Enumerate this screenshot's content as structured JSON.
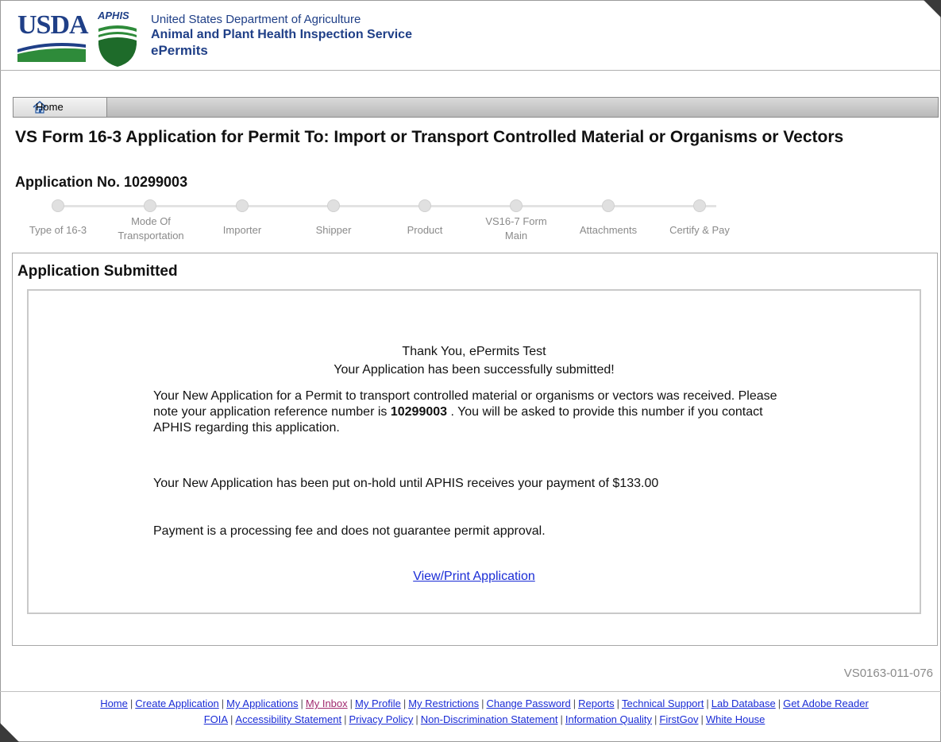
{
  "header": {
    "usda_logo_text": "USDA",
    "aphis_label": "APHIS",
    "line1": "United States Department of Agriculture",
    "line2": "Animal and Plant Health Inspection Service",
    "line3": "ePermits"
  },
  "nav": {
    "home_label": "Home"
  },
  "page": {
    "title": "VS Form 16-3 Application for Permit To: Import or Transport Controlled Material or Organisms or Vectors",
    "application_no": "Application No. 10299003"
  },
  "wizard": {
    "steps": [
      {
        "label": "Type of 16-3"
      },
      {
        "label": "Mode Of Transportation"
      },
      {
        "label": "Importer"
      },
      {
        "label": "Shipper"
      },
      {
        "label": "Product"
      },
      {
        "label": "VS16-7 Form Main"
      },
      {
        "label": "Attachments"
      },
      {
        "label": "Certify & Pay"
      }
    ]
  },
  "panel": {
    "section_title": "Application Submitted",
    "thank_you": "Thank You, ePermits Test",
    "success": "Your Application has been successfully submitted!",
    "para1_before": "Your New Application for a Permit to transport controlled material or organisms or vectors was received. Please note your application reference number is ",
    "para1_ref": "10299003",
    "para1_after": " . You will be asked to provide this number if you contact APHIS regarding this application.",
    "para2": "Your New Application has been put on-hold until APHIS receives your payment of $133.00",
    "para3": "Payment is a processing fee and does not guarantee permit approval.",
    "view_link": "View/Print Application"
  },
  "form_code": "VS0163-011-076",
  "footer": {
    "row1": [
      "Home",
      "Create Application",
      "My Applications",
      "My Inbox",
      "My Profile",
      "My Restrictions",
      "Change Password",
      "Reports",
      "Technical Support",
      "Lab Database",
      "Get Adobe Reader"
    ],
    "row2": [
      "FOIA",
      "Accessibility Statement",
      "Privacy Policy",
      "Non-Discrimination Statement",
      "Information Quality",
      "FirstGov",
      "White House"
    ]
  },
  "colors": {
    "brand_blue": "#1f3f87",
    "brand_green": "#2e8b3a",
    "link": "#1a2cd6",
    "visited_link": "#a0286e"
  }
}
